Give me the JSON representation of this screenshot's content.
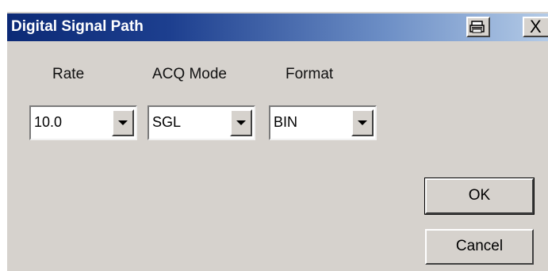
{
  "window": {
    "title": "Digital Signal Path",
    "print_icon": "printer-icon",
    "close_label": "X"
  },
  "fields": {
    "rate": {
      "label": "Rate",
      "value": "10.0"
    },
    "acq_mode": {
      "label": "ACQ Mode",
      "value": "SGL"
    },
    "format": {
      "label": "Format",
      "value": "BIN"
    }
  },
  "buttons": {
    "ok": "OK",
    "cancel": "Cancel"
  }
}
